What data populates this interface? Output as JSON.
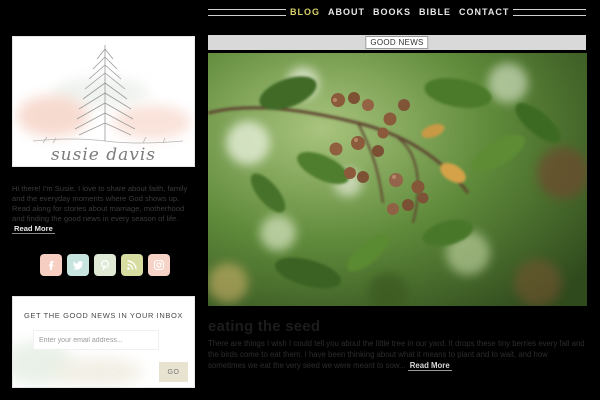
{
  "nav": {
    "items": [
      {
        "label": "Blog",
        "active": true
      },
      {
        "label": "About",
        "active": false
      },
      {
        "label": "Books",
        "active": false
      },
      {
        "label": "Bible",
        "active": false
      },
      {
        "label": "Contact",
        "active": false
      }
    ]
  },
  "sidebar": {
    "logo_text": "susie davis",
    "bio": "Hi there! I'm Susie. I love to share about faith, family and the everyday moments where God shows up. Read along for stories about marriage, motherhood and finding the good news in every season of life.",
    "bio_more": "Read More",
    "social": [
      {
        "icon": "facebook-icon",
        "color": "#f7cfc2"
      },
      {
        "icon": "twitter-icon",
        "color": "#c8e4df"
      },
      {
        "icon": "pinterest-icon",
        "color": "#dfe9d6"
      },
      {
        "icon": "rss-icon",
        "color": "#d7dca0"
      },
      {
        "icon": "instagram-icon",
        "color": "#f6d3c6"
      }
    ]
  },
  "subscribe": {
    "title": "GET THE GOOD NEWS IN YOUR INBOX",
    "placeholder": "Enter your email address...",
    "button": "GO"
  },
  "main": {
    "section_label": "GOOD NEWS",
    "post_title": "eating the seed",
    "excerpt": "There are things I wish I could tell you about the little tree in our yard. It drops these tiny berries every fall and the birds come to eat them. I have been thinking about what it means to plant and to wait, and how sometimes we eat the very seed we were meant to sow...",
    "excerpt_more": "Read More"
  },
  "colors": {
    "nav_active": "#d9cf6a",
    "bar_bg": "#d9d9d9",
    "page_bg": "#000000"
  }
}
